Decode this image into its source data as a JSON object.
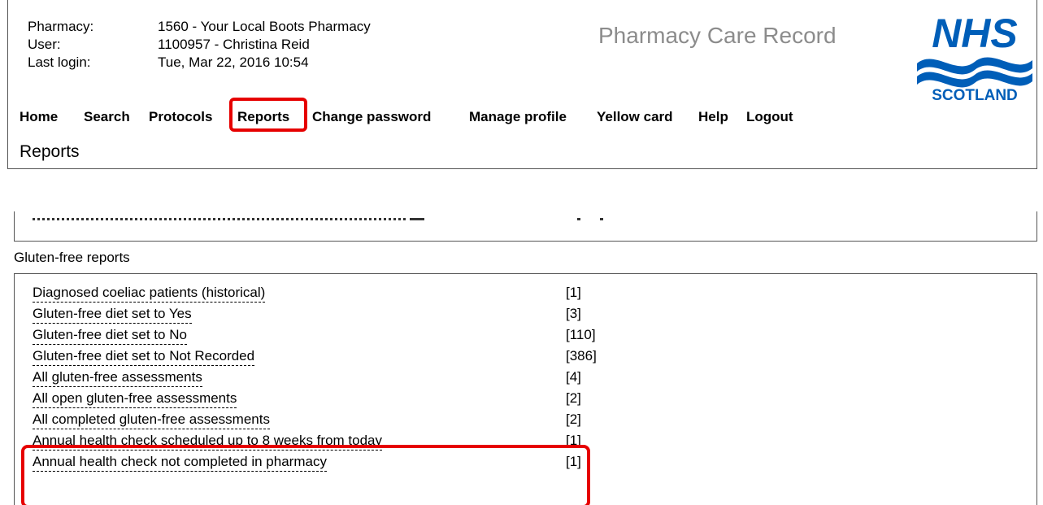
{
  "user_info": {
    "pharmacy_label": "Pharmacy:",
    "pharmacy_value": "1560 - Your Local Boots Pharmacy",
    "user_label": "User:",
    "user_value": "1100957 - Christina Reid",
    "last_login_label": "Last login:",
    "last_login_value": "Tue, Mar 22, 2016 10:54"
  },
  "app_title": "Pharmacy Care Record",
  "logo": {
    "text_main": "NHS",
    "text_sub": "SCOTLAND",
    "brand_color": "#005eb8",
    "icon": "nhs-scotland-logo"
  },
  "nav": [
    {
      "label": "Home"
    },
    {
      "label": "Search"
    },
    {
      "label": "Protocols"
    },
    {
      "label": "Reports",
      "active": true
    },
    {
      "label": "Change password"
    },
    {
      "label": "Manage profile"
    },
    {
      "label": "Yellow card"
    },
    {
      "label": "Help"
    },
    {
      "label": "Logout"
    }
  ],
  "page_title": "Reports",
  "gluten_section": {
    "heading": "Gluten-free reports",
    "reports": [
      {
        "label": "Diagnosed coeliac patients (historical)",
        "count": "[1]"
      },
      {
        "label": "Gluten-free diet set to Yes",
        "count": "[3]"
      },
      {
        "label": "Gluten-free diet set to No",
        "count": "[110]"
      },
      {
        "label": "Gluten-free diet set to Not Recorded",
        "count": "[386]"
      },
      {
        "label": "All gluten-free assessments",
        "count": "[4]"
      },
      {
        "label": "All open gluten-free assessments",
        "count": "[2]"
      },
      {
        "label": "All completed gluten-free assessments",
        "count": "[2]"
      },
      {
        "label": "Annual health check scheduled up to 8 weeks from today",
        "count": "[1]",
        "highlighted": true
      },
      {
        "label": "Annual health check not completed in pharmacy",
        "count": "[1]",
        "highlighted": true
      }
    ]
  },
  "highlight_color": "#e60000"
}
